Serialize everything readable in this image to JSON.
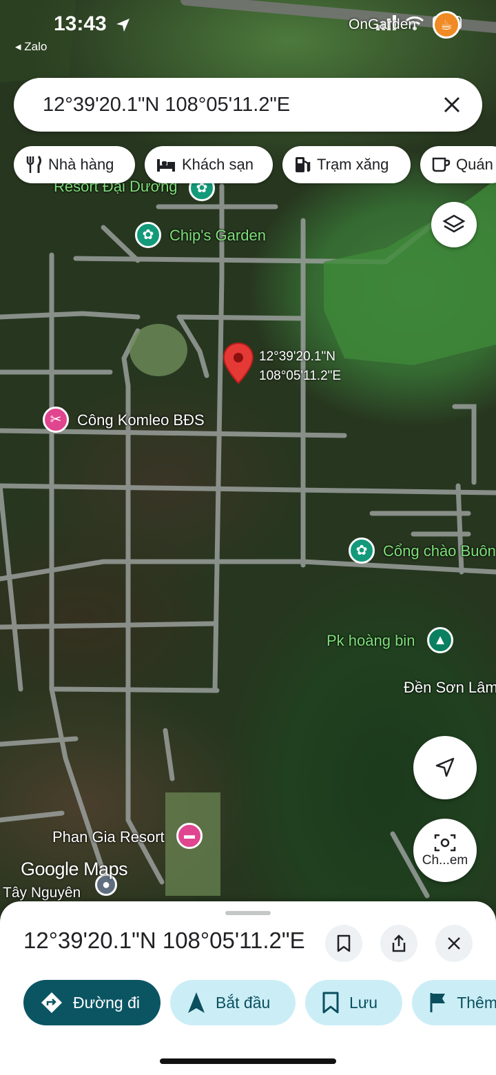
{
  "status_bar": {
    "time": "13:43",
    "back_app": "◂ Zalo",
    "icons": [
      "location-arrow-icon",
      "signal-icon",
      "wifi-icon",
      "battery-icon"
    ]
  },
  "search": {
    "value": "12°39'20.1\"N 108°05'11.2\"E",
    "clear_icon": "close-icon"
  },
  "chips": [
    {
      "label": "Nhà hàng",
      "icon": "fork-knife-icon"
    },
    {
      "label": "Khách sạn",
      "icon": "bed-icon"
    },
    {
      "label": "Trạm xăng",
      "icon": "fuel-pump-icon"
    },
    {
      "label": "Quán",
      "icon": "coffee-cup-icon"
    }
  ],
  "map": {
    "dropped_pin": {
      "line1": "12°39'20.1\"N",
      "line2": "108°05'11.2\"E"
    },
    "pois": [
      {
        "name": "OnGarden",
        "icon": "coffee-cup-icon"
      },
      {
        "name": "Resort Đại Dương",
        "icon": "flower-icon"
      },
      {
        "name": "Chip's Garden",
        "icon": "flower-icon"
      },
      {
        "name": "Công Komleo BĐS",
        "icon": "tools-icon"
      },
      {
        "name": "Cổng chào Buôn",
        "icon": "flower-icon"
      },
      {
        "name": "Pk hoàng bin",
        "icon": "tree-icon"
      },
      {
        "name": "Đền Sơn Lâm",
        "icon": ""
      },
      {
        "name": "Phan Gia Resort",
        "icon": "bed-icon"
      },
      {
        "name": "Tây Nguyên",
        "icon": "place-icon"
      }
    ],
    "attribution": "Google Maps",
    "lens_label": "Ch...em"
  },
  "sheet": {
    "title": "12°39'20.1\"N 108°05'11.2\"E",
    "actions": [
      {
        "label": "Đường đi",
        "icon": "directions-icon",
        "style": "primary"
      },
      {
        "label": "Bắt đầu",
        "icon": "navigation-arrow-icon",
        "style": "secondary"
      },
      {
        "label": "Lưu",
        "icon": "bookmark-icon",
        "style": "secondary"
      },
      {
        "label": "Thêm",
        "icon": "flag-icon",
        "style": "secondary"
      }
    ]
  },
  "colors": {
    "primary_button": "#0b5563",
    "secondary_button": "#cbeef6",
    "pin": "#e53935",
    "poi_green_label": "#7fe07a"
  }
}
